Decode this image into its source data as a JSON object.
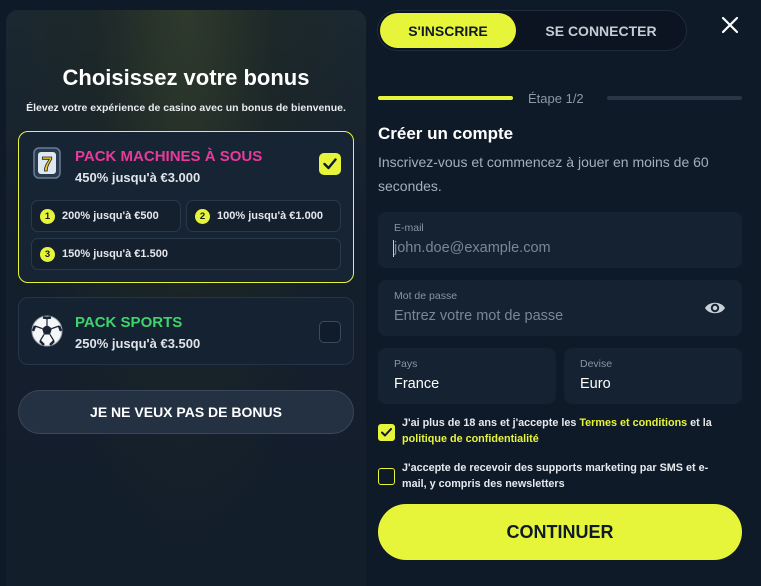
{
  "bonus_panel": {
    "title": "Choisissez votre bonus",
    "subtitle": "Élevez votre expérience de casino avec un bonus de bienvenue.",
    "packs": [
      {
        "name": "PACK MACHINES À SOUS",
        "offer": "450% jusqu'à €3.000",
        "selected": true,
        "icon": "slot-seven-icon",
        "tiers": [
          {
            "num": "1",
            "text": "200% jusqu'à €500"
          },
          {
            "num": "2",
            "text": "100% jusqu'à €1.000"
          },
          {
            "num": "3",
            "text": "150% jusqu'à €1.500"
          }
        ]
      },
      {
        "name": "PACK SPORTS",
        "offer": "250% jusqu'à €3.500",
        "selected": false,
        "icon": "soccer-ball-icon"
      }
    ],
    "no_bonus_label": "JE NE VEUX PAS DE BONUS"
  },
  "tabs": {
    "signup": "S'INSCRIRE",
    "login": "SE CONNECTER"
  },
  "step": {
    "label": "Étape 1/2",
    "current": 1,
    "total": 2
  },
  "form": {
    "title": "Créer un compte",
    "description": "Inscrivez-vous et commencez à jouer en moins de 60 secondes.",
    "email": {
      "label": "E-mail",
      "placeholder": "john.doe@example.com"
    },
    "password": {
      "label": "Mot de passe",
      "placeholder": "Entrez votre mot de passe"
    },
    "country": {
      "label": "Pays",
      "value": "France"
    },
    "currency": {
      "label": "Devise",
      "value": "Euro"
    },
    "terms": {
      "checked": true,
      "text_before": "J'ai plus de 18 ans et j'accepte les ",
      "link1": "Termes et conditions",
      "text_middle": " et la ",
      "link2": "politique de confidentialité"
    },
    "marketing": {
      "checked": false,
      "text": "J'accepte de recevoir des supports marketing par SMS et e-mail, y compris des newsletters"
    },
    "submit_label": "CONTINUER"
  },
  "colors": {
    "accent": "#e7f53a",
    "background": "#0f1a28",
    "slots_title": "#e83a9c",
    "sports_title": "#3ed46a"
  }
}
